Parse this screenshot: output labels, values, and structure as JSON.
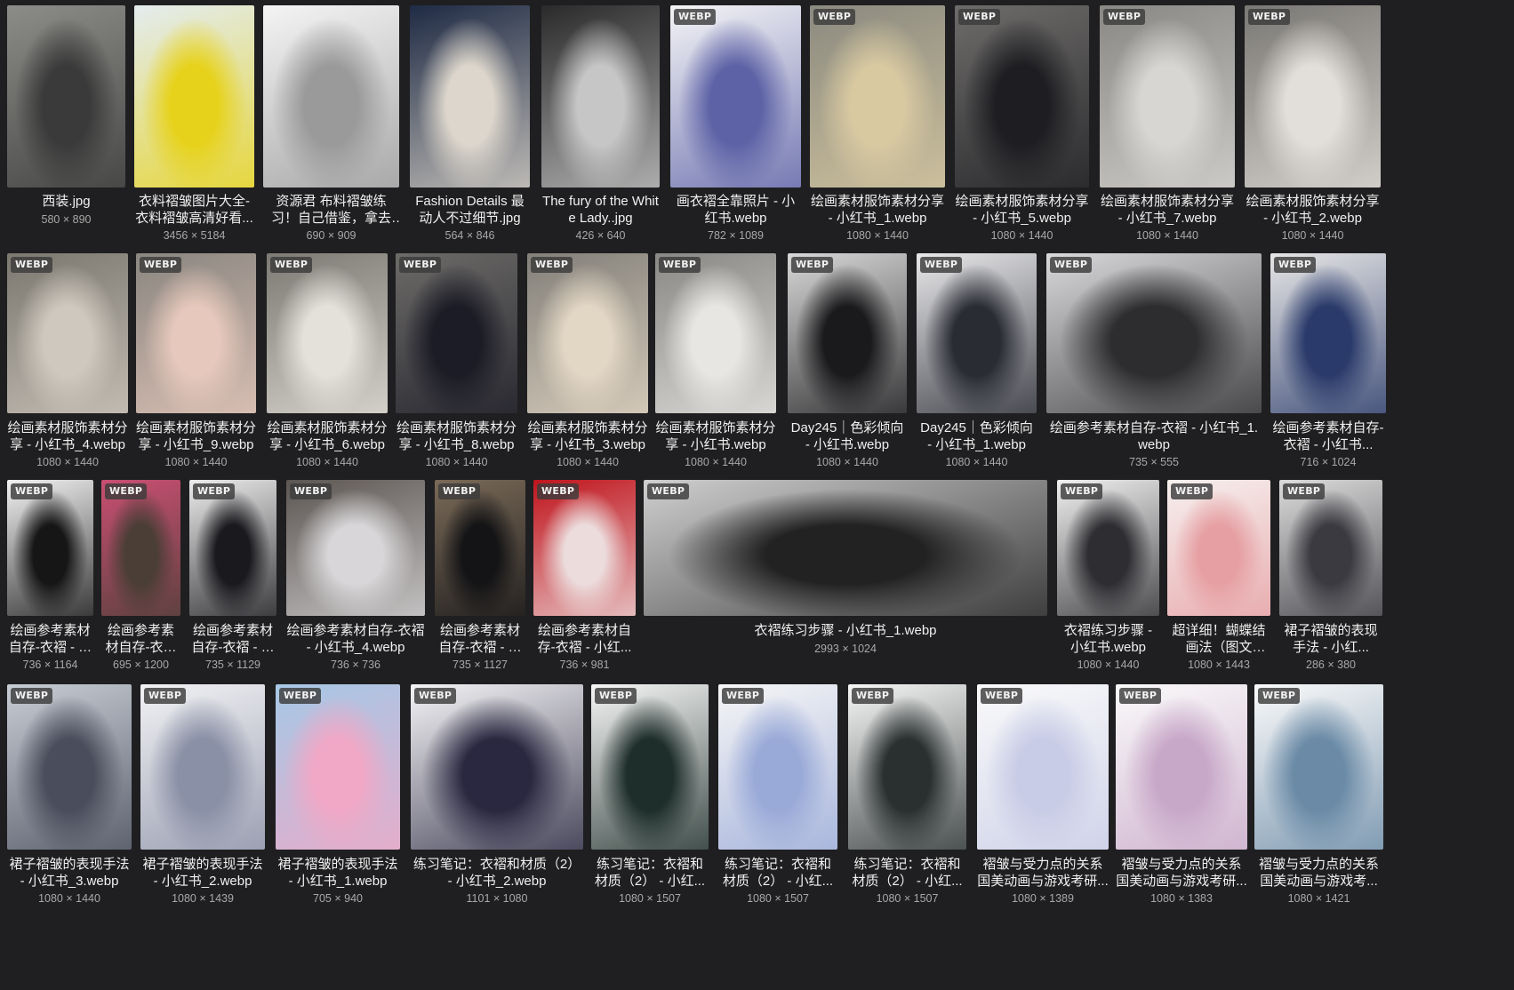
{
  "badge": "WEBP",
  "tiles": [
    {
      "title": "西装.jpg",
      "dims": "580 × 890",
      "webp": false,
      "colors": [
        "#8c8c88",
        "#3a3a3a"
      ]
    },
    {
      "title": "衣料褶皱图片大全-衣料褶皱高清好看...",
      "dims": "3456 × 5184",
      "webp": false,
      "colors": [
        "#e4ecef",
        "#e6d21b"
      ]
    },
    {
      "title": "资源君 布料褶皱练习！自己借鉴，拿去练...",
      "dims": "690 × 909",
      "webp": false,
      "colors": [
        "#f4f4f4",
        "#9a9a9a"
      ]
    },
    {
      "title": "Fashion Details 最动人不过细节.jpg",
      "dims": "564 × 846",
      "webp": false,
      "colors": [
        "#1e2a44",
        "#dcd6cc"
      ]
    },
    {
      "title": "The fury of the White Lady..jpg",
      "dims": "426 × 640",
      "webp": false,
      "colors": [
        "#2a2a2a",
        "#c6c6c6"
      ]
    },
    {
      "title": "画衣褶全靠照片 - 小红书.webp",
      "dims": "782 × 1089",
      "webp": true,
      "colors": [
        "#f4f4f6",
        "#5d62a6"
      ]
    },
    {
      "title": "绘画素材服饰素材分享 - 小红书_1.webp",
      "dims": "1080 × 1440",
      "webp": true,
      "colors": [
        "#8b8a80",
        "#d8c9a1"
      ]
    },
    {
      "title": "绘画素材服饰素材分享 - 小红书_5.webp",
      "dims": "1080 × 1440",
      "webp": true,
      "colors": [
        "#6e6c6a",
        "#1e1e22"
      ]
    },
    {
      "title": "绘画素材服饰素材分享 - 小红书_7.webp",
      "dims": "1080 × 1440",
      "webp": true,
      "colors": [
        "#8a8884",
        "#d8d6d2"
      ]
    },
    {
      "title": "绘画素材服饰素材分享 - 小红书_2.webp",
      "dims": "1080 × 1440",
      "webp": true,
      "colors": [
        "#7a7874",
        "#e2deda"
      ]
    },
    {
      "title": "绘画素材服饰素材分享 - 小红书_4.webp",
      "dims": "1080 × 1440",
      "webp": true,
      "colors": [
        "#7b7870",
        "#cfc8be"
      ]
    },
    {
      "title": "绘画素材服饰素材分享 - 小红书_9.webp",
      "dims": "1080 × 1440",
      "webp": true,
      "colors": [
        "#8a8680",
        "#e6c8bc"
      ]
    },
    {
      "title": "绘画素材服饰素材分享 - 小红书_6.webp",
      "dims": "1080 × 1440",
      "webp": true,
      "colors": [
        "#7d7a74",
        "#e4e0da"
      ]
    },
    {
      "title": "绘画素材服饰素材分享 - 小红书_8.webp",
      "dims": "1080 × 1440",
      "webp": true,
      "colors": [
        "#6d6b68",
        "#1c1c26"
      ]
    },
    {
      "title": "绘画素材服饰素材分享 - 小红书_3.webp",
      "dims": "1080 × 1440",
      "webp": true,
      "colors": [
        "#83807a",
        "#e2d6c4"
      ]
    },
    {
      "title": "绘画素材服饰素材分享 - 小红书.webp",
      "dims": "1080 × 1440",
      "webp": true,
      "colors": [
        "#8a8884",
        "#e8e6e2"
      ]
    },
    {
      "title": "Day245｜色彩倾向 - 小红书.webp",
      "dims": "1080 × 1440",
      "webp": true,
      "colors": [
        "#d8d8d8",
        "#1a1a1c"
      ]
    },
    {
      "title": "Day245｜色彩倾向 - 小红书_1.webp",
      "dims": "1080 × 1440",
      "webp": true,
      "colors": [
        "#e8e8ea",
        "#2a2c34"
      ]
    },
    {
      "title": "绘画参考素材自存-衣褶 - 小红书_1.webp",
      "dims": "735 × 555",
      "webp": true,
      "colors": [
        "#d9d9db",
        "#2d2d30"
      ]
    },
    {
      "title": "绘画参考素材自存-衣褶 - 小红书...",
      "dims": "716 × 1024",
      "webp": true,
      "colors": [
        "#e6e6e6",
        "#2a3a6a"
      ]
    },
    {
      "title": "绘画参考素材自存-衣褶 - 小红...",
      "dims": "736 × 1164",
      "webp": true,
      "colors": [
        "#f2f2f2",
        "#161616"
      ]
    },
    {
      "title": "绘画参考素材自存-衣褶 - 小红...",
      "dims": "695 × 1200",
      "webp": true,
      "colors": [
        "#c94f72",
        "#4a3e36"
      ]
    },
    {
      "title": "绘画参考素材自存-衣褶 - 小红...",
      "dims": "735 × 1129",
      "webp": true,
      "colors": [
        "#ececec",
        "#1a1a1e"
      ]
    },
    {
      "title": "绘画参考素材自存-衣褶 - 小红书_4.webp",
      "dims": "736 × 736",
      "webp": true,
      "colors": [
        "#5c5652",
        "#d8d6d8"
      ]
    },
    {
      "title": "绘画参考素材自存-衣褶 - 小红...",
      "dims": "735 × 1127",
      "webp": true,
      "colors": [
        "#7a6a58",
        "#141416"
      ]
    },
    {
      "title": "绘画参考素材自存-衣褶 - 小红...",
      "dims": "736 × 981",
      "webp": true,
      "colors": [
        "#c0141c",
        "#ecdcdc"
      ]
    },
    {
      "title": "衣褶练习步骤 - 小红书_1.webp",
      "dims": "2993 × 1024",
      "webp": true,
      "colors": [
        "#cfcfcf",
        "#222222"
      ]
    },
    {
      "title": "衣褶练习步骤 - 小红书.webp",
      "dims": "1080 × 1440",
      "webp": true,
      "colors": [
        "#f0f0f0",
        "#2e2e32"
      ]
    },
    {
      "title": "超详细！蝴蝶结画法（图文版）...",
      "dims": "1080 × 1443",
      "webp": true,
      "colors": [
        "#f6f0ee",
        "#e6a0a4"
      ]
    },
    {
      "title": "裙子褶皱的表现手法 - 小红...",
      "dims": "286 × 380",
      "webp": true,
      "colors": [
        "#dcdcdc",
        "#3a3a40"
      ]
    },
    {
      "title": "裙子褶皱的表现手法 - 小红书_3.webp",
      "dims": "1080 × 1440",
      "webp": true,
      "colors": [
        "#c8ccd4",
        "#4a4e5c"
      ]
    },
    {
      "title": "裙子褶皱的表现手法 - 小红书_2.webp",
      "dims": "1080 × 1439",
      "webp": true,
      "colors": [
        "#f2f2f4",
        "#8a90a6"
      ]
    },
    {
      "title": "裙子褶皱的表现手法 - 小红书_1.webp",
      "dims": "705 × 940",
      "webp": true,
      "colors": [
        "#a6c8e6",
        "#f0a8c6"
      ]
    },
    {
      "title": "练习笔记：衣褶和材质（2） - 小红书_2.webp",
      "dims": "1101 × 1080",
      "webp": true,
      "colors": [
        "#f4f4f6",
        "#2a2840"
      ]
    },
    {
      "title": "练习笔记：衣褶和材质（2） - 小红...",
      "dims": "1080 × 1507",
      "webp": true,
      "colors": [
        "#f6f6f6",
        "#1e2e2a"
      ]
    },
    {
      "title": "练习笔记：衣褶和材质（2） - 小红...",
      "dims": "1080 × 1507",
      "webp": true,
      "colors": [
        "#f6f6f6",
        "#9aaad8"
      ]
    },
    {
      "title": "练习笔记：衣褶和材质（2） - 小红...",
      "dims": "1080 × 1507",
      "webp": true,
      "colors": [
        "#f6f6f6",
        "#2a3030"
      ]
    },
    {
      "title": "褶皱与受力点的关系 国美动画与游戏考研...",
      "dims": "1080 × 1389",
      "webp": true,
      "colors": [
        "#fafafa",
        "#c8cce6"
      ]
    },
    {
      "title": "褶皱与受力点的关系 国美动画与游戏考研...",
      "dims": "1080 × 1383",
      "webp": true,
      "colors": [
        "#fafafa",
        "#c8a8c8"
      ]
    },
    {
      "title": "褶皱与受力点的关系 国美动画与游戏考...",
      "dims": "1080 × 1421",
      "webp": true,
      "colors": [
        "#fafafa",
        "#6a8aa6"
      ]
    }
  ]
}
